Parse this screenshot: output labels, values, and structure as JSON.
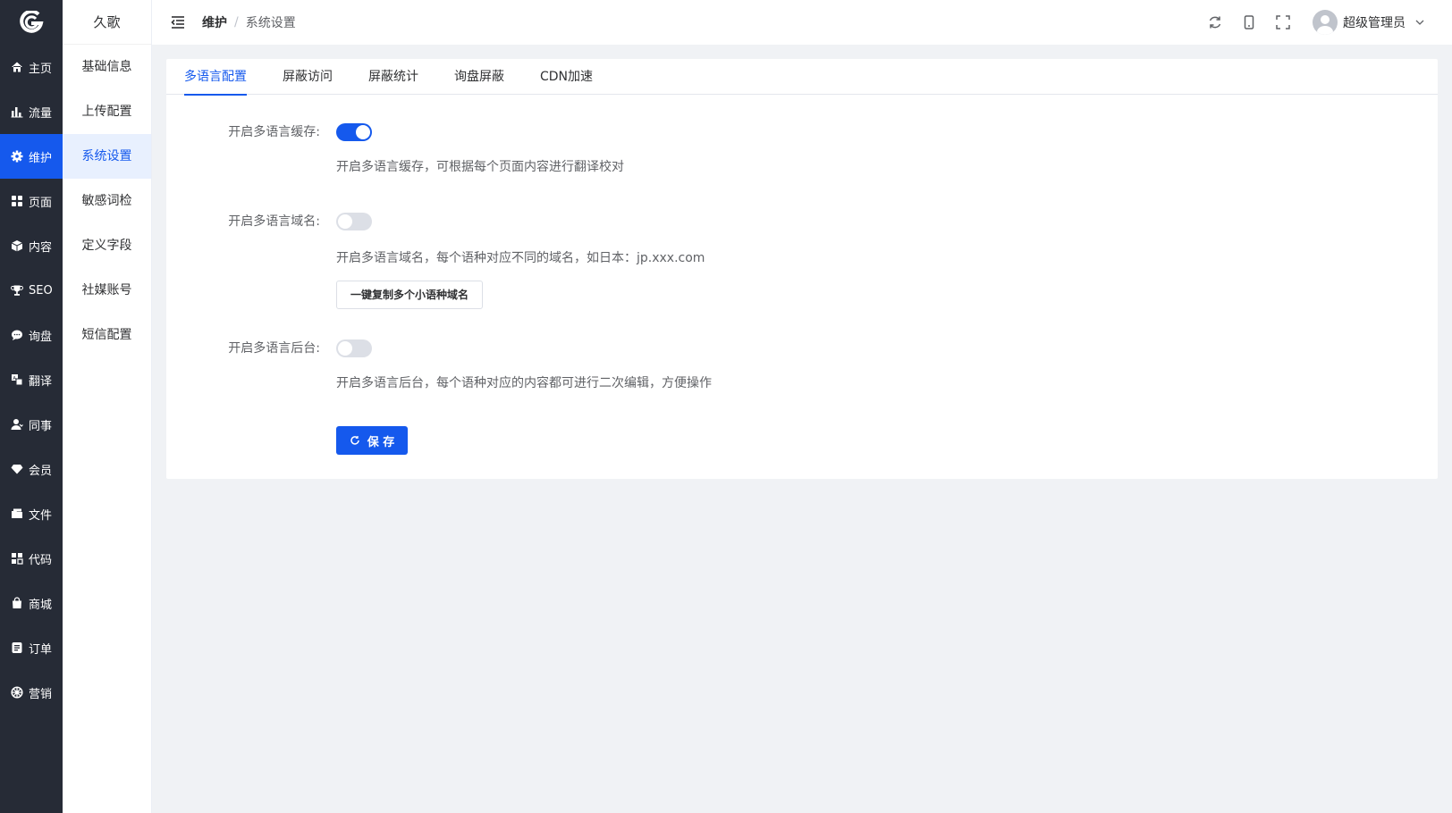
{
  "sidebar": {
    "items": [
      {
        "label": "主页",
        "icon": "home-icon"
      },
      {
        "label": "流量",
        "icon": "bar-chart-icon"
      },
      {
        "label": "维护",
        "icon": "gear-icon",
        "active": true
      },
      {
        "label": "页面",
        "icon": "grid-icon"
      },
      {
        "label": "内容",
        "icon": "cube-icon"
      },
      {
        "label": "SEO",
        "icon": "trophy-icon"
      },
      {
        "label": "询盘",
        "icon": "chat-icon"
      },
      {
        "label": "翻译",
        "icon": "translate-icon"
      },
      {
        "label": "同事",
        "icon": "user-icon"
      },
      {
        "label": "会员",
        "icon": "diamond-icon"
      },
      {
        "label": "文件",
        "icon": "folder-icon"
      },
      {
        "label": "代码",
        "icon": "code-icon"
      },
      {
        "label": "商城",
        "icon": "shopping-bag-icon"
      },
      {
        "label": "订单",
        "icon": "order-icon"
      },
      {
        "label": "营销",
        "icon": "marketing-icon"
      }
    ]
  },
  "submenu": {
    "title": "久歌",
    "items": [
      "基础信息",
      "上传配置",
      "系统设置",
      "敏感词检",
      "定义字段",
      "社媒账号",
      "短信配置"
    ],
    "active_index": 2
  },
  "header": {
    "breadcrumb": [
      "维护",
      "系统设置"
    ],
    "breadcrumb_sep": "/",
    "user_name": "超级管理员"
  },
  "tabs": [
    "多语言配置",
    "屏蔽访问",
    "屏蔽统计",
    "询盘屏蔽",
    "CDN加速"
  ],
  "form": {
    "cache": {
      "label": "开启多语言缓存:",
      "on": true,
      "hint": "开启多语言缓存，可根据每个页面内容进行翻译校对"
    },
    "domain": {
      "label": "开启多语言域名:",
      "on": false,
      "hint": "开启多语言域名，每个语种对应不同的域名，如日本：jp.xxx.com",
      "button": "一键复制多个小语种域名"
    },
    "backend": {
      "label": "开启多语言后台:",
      "on": false,
      "hint": "开启多语言后台，每个语种对应的内容都可进行二次编辑，方便操作"
    },
    "save_label": "保 存"
  },
  "colors": {
    "primary": "#1559ed",
    "sidebar": "#262b36"
  }
}
